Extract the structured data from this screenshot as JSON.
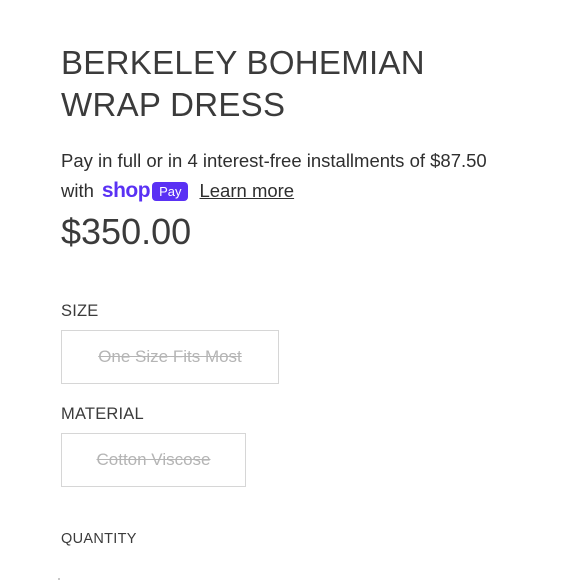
{
  "product": {
    "title_line1": "BERKELEY BOHEMIAN",
    "title_line2": "WRAP DRESS",
    "price": "$350.00"
  },
  "installments": {
    "text": "Pay in full or in 4 interest-free installments of $87.50",
    "with": "with",
    "shop_word": "shop",
    "pay_badge": "Pay",
    "learn_more": "Learn more",
    "brand_color": "#5a31f4"
  },
  "options": {
    "size": {
      "label": "SIZE",
      "value": "One Size Fits Most"
    },
    "material": {
      "label": "MATERIAL",
      "value": "Cotton Viscose"
    }
  },
  "quantity": {
    "label": "QUANTITY"
  }
}
